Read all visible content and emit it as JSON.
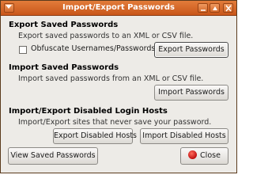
{
  "window": {
    "title": "Import/Export Passwords"
  },
  "export_section": {
    "heading": "Export Saved Passwords",
    "description": "Export saved passwords to an XML or CSV file.",
    "checkbox_label": "Obfuscate Usernames/Passwords",
    "checkbox_checked": false,
    "button_label": "Export Passwords"
  },
  "import_section": {
    "heading": "Import Saved Passwords",
    "description": "Import saved passwords from an XML or CSV file.",
    "button_label": "Import Passwords"
  },
  "disabled_hosts_section": {
    "heading": "Import/Export Disabled Login Hosts",
    "description": "Import/Export sites that never save your password.",
    "export_button_label": "Export Disabled Hosts",
    "import_button_label": "Import Disabled Hosts"
  },
  "footer": {
    "view_button_label": "View Saved Passwords",
    "close_button_label": "Close",
    "close_icon": "close-icon"
  },
  "colors": {
    "titlebar": "#d2652a",
    "dialog_background": "#edebe7",
    "close_icon": "#d81e1e"
  }
}
